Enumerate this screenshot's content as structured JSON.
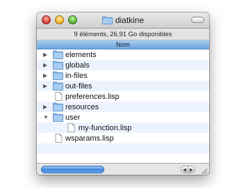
{
  "window": {
    "title": "diatkine"
  },
  "status": {
    "text": "9 éléments, 26,91 Go disponibles"
  },
  "columns": {
    "name_header": "Nom"
  },
  "rows": [
    {
      "label": "elements",
      "kind": "folder",
      "disclosure": "collapsed",
      "indent": 0
    },
    {
      "label": "globals",
      "kind": "folder",
      "disclosure": "collapsed",
      "indent": 0
    },
    {
      "label": "in-files",
      "kind": "folder",
      "disclosure": "collapsed",
      "indent": 0
    },
    {
      "label": "out-files",
      "kind": "folder",
      "disclosure": "collapsed",
      "indent": 0
    },
    {
      "label": "preferences.lisp",
      "kind": "file",
      "disclosure": "none",
      "indent": 0
    },
    {
      "label": "resources",
      "kind": "folder",
      "disclosure": "collapsed",
      "indent": 0
    },
    {
      "label": "user",
      "kind": "folder",
      "disclosure": "expanded",
      "indent": 0
    },
    {
      "label": "my-function.lisp",
      "kind": "file",
      "disclosure": "none",
      "indent": 1
    },
    {
      "label": "wsparams.lisp",
      "kind": "file",
      "disclosure": "none",
      "indent": 0
    }
  ],
  "colors": {
    "folder_blue": "#7fb3e6",
    "selection_header": "#6fa5dd",
    "alt_row": "#edf3fe"
  },
  "icons": {
    "folder": "folder-icon",
    "file": "document-icon"
  }
}
